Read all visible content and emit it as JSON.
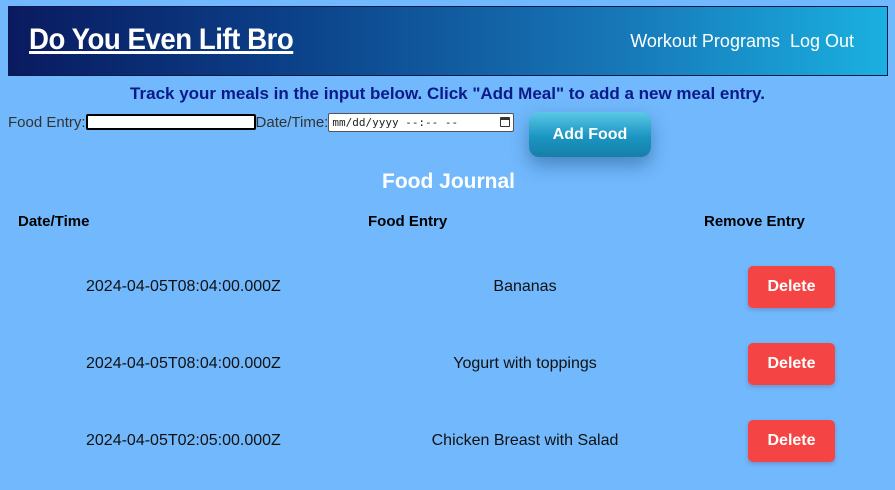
{
  "header": {
    "brand": "Do You Even Lift Bro",
    "nav": {
      "workout_programs": "Workout Programs",
      "log_out": "Log Out"
    }
  },
  "instructions": "Track your meals in the input below. Click \"Add Meal\" to add a new meal entry.",
  "form": {
    "food_label": "Food Entry:",
    "food_value": "",
    "date_label": "Date/Time:",
    "date_placeholder": "mm/dd/yyyy --:-- --",
    "add_button": "Add Food"
  },
  "journal": {
    "title": "Food Journal",
    "columns": {
      "date": "Date/Time",
      "food": "Food Entry",
      "remove": "Remove Entry"
    },
    "rows": [
      {
        "date": "2024-04-05T08:04:00.000Z",
        "food": "Bananas",
        "action": "Delete"
      },
      {
        "date": "2024-04-05T08:04:00.000Z",
        "food": "Yogurt with toppings",
        "action": "Delete"
      },
      {
        "date": "2024-04-05T02:05:00.000Z",
        "food": "Chicken Breast with Salad",
        "action": "Delete"
      }
    ]
  }
}
